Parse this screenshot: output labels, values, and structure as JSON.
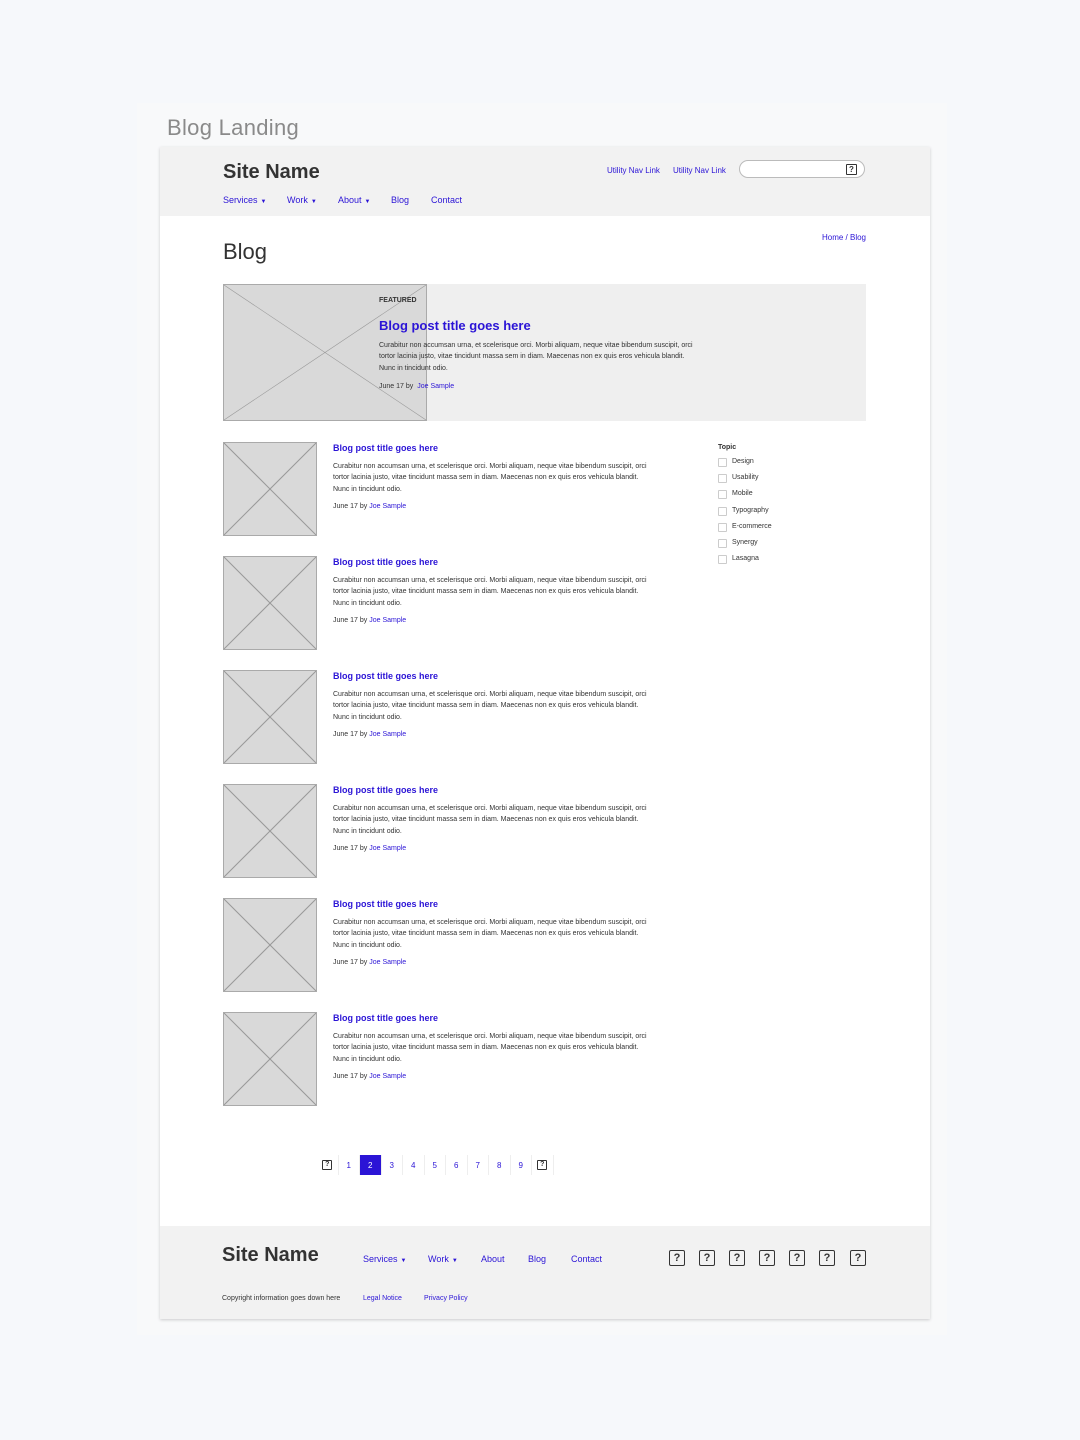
{
  "frame_title": "Blog Landing",
  "header": {
    "site_name": "Site Name",
    "utility_links": [
      "Utility Nav Link",
      "Utility Nav Link"
    ],
    "search_icon": "?",
    "nav": [
      {
        "label": "Services",
        "dropdown": true
      },
      {
        "label": "Work",
        "dropdown": true
      },
      {
        "label": "About",
        "dropdown": true
      },
      {
        "label": "Blog",
        "dropdown": false
      },
      {
        "label": "Contact",
        "dropdown": false
      }
    ]
  },
  "breadcrumb": "Home / Blog",
  "page_title": "Blog",
  "featured": {
    "label": "FEATURED",
    "title": "Blog post title goes here",
    "excerpt": "Curabitur non accumsan urna, et scelerisque orci. Morbi aliquam, neque vitae bibendum suscipit, orci tortor lacinia justo, vitae tincidunt massa sem in diam. Maecenas non ex quis eros vehicula blandit. Nunc in tincidunt odio.",
    "date": "June 17",
    "by": "by",
    "author": "Joe Sample"
  },
  "posts": [
    {
      "title": "Blog post title goes here",
      "excerpt": "Curabitur non accumsan urna, et scelerisque orci. Morbi aliquam, neque vitae bibendum suscipit, orci tortor lacinia justo, vitae tincidunt massa sem in diam. Maecenas non ex quis eros vehicula blandit. Nunc in tincidunt odio.",
      "date": "June 17",
      "by": "by",
      "author": "Joe Sample"
    },
    {
      "title": "Blog post title goes here",
      "excerpt": "Curabitur non accumsan urna, et scelerisque orci. Morbi aliquam, neque vitae bibendum suscipit, orci tortor lacinia justo, vitae tincidunt massa sem in diam. Maecenas non ex quis eros vehicula blandit. Nunc in tincidunt odio.",
      "date": "June 17",
      "by": "by",
      "author": "Joe Sample"
    },
    {
      "title": "Blog post title goes here",
      "excerpt": "Curabitur non accumsan urna, et scelerisque orci. Morbi aliquam, neque vitae bibendum suscipit, orci tortor lacinia justo, vitae tincidunt massa sem in diam. Maecenas non ex quis eros vehicula blandit. Nunc in tincidunt odio.",
      "date": "June 17",
      "by": "by",
      "author": "Joe Sample"
    },
    {
      "title": "Blog post title goes here",
      "excerpt": "Curabitur non accumsan urna, et scelerisque orci. Morbi aliquam, neque vitae bibendum suscipit, orci tortor lacinia justo, vitae tincidunt massa sem in diam. Maecenas non ex quis eros vehicula blandit. Nunc in tincidunt odio.",
      "date": "June 17",
      "by": "by",
      "author": "Joe Sample"
    },
    {
      "title": "Blog post title goes here",
      "excerpt": "Curabitur non accumsan urna, et scelerisque orci. Morbi aliquam, neque vitae bibendum suscipit, orci tortor lacinia justo, vitae tincidunt massa sem in diam. Maecenas non ex quis eros vehicula blandit. Nunc in tincidunt odio.",
      "date": "June 17",
      "by": "by",
      "author": "Joe Sample"
    },
    {
      "title": "Blog post title goes here",
      "excerpt": "Curabitur non accumsan urna, et scelerisque orci. Morbi aliquam, neque vitae bibendum suscipit, orci tortor lacinia justo, vitae tincidunt massa sem in diam. Maecenas non ex quis eros vehicula blandit. Nunc in tincidunt odio.",
      "date": "June 17",
      "by": "by",
      "author": "Joe Sample"
    }
  ],
  "topic_filter": {
    "heading": "Topic",
    "options": [
      "Design",
      "Usability",
      "Mobile",
      "Typography",
      "E-commerce",
      "Synergy",
      "Lasagna"
    ]
  },
  "pagination": {
    "prev_icon": "?",
    "next_icon": "?",
    "pages": [
      "1",
      "2",
      "3",
      "4",
      "5",
      "6",
      "7",
      "8",
      "9"
    ],
    "current": "2"
  },
  "footer": {
    "site_name": "Site Name",
    "nav": [
      {
        "label": "Services",
        "dropdown": true
      },
      {
        "label": "Work",
        "dropdown": true
      },
      {
        "label": "About",
        "dropdown": false
      },
      {
        "label": "Blog",
        "dropdown": false
      },
      {
        "label": "Contact",
        "dropdown": false
      }
    ],
    "social_icons": [
      "?",
      "?",
      "?",
      "?",
      "?",
      "?",
      "?"
    ],
    "copyright": "Copyright information goes down here",
    "legal_links": [
      "Legal Notice",
      "Privacy Policy"
    ]
  },
  "colors": {
    "link": "#2b14d6",
    "placeholder": "#d9d9d9",
    "header_bg": "#f2f2f2"
  }
}
